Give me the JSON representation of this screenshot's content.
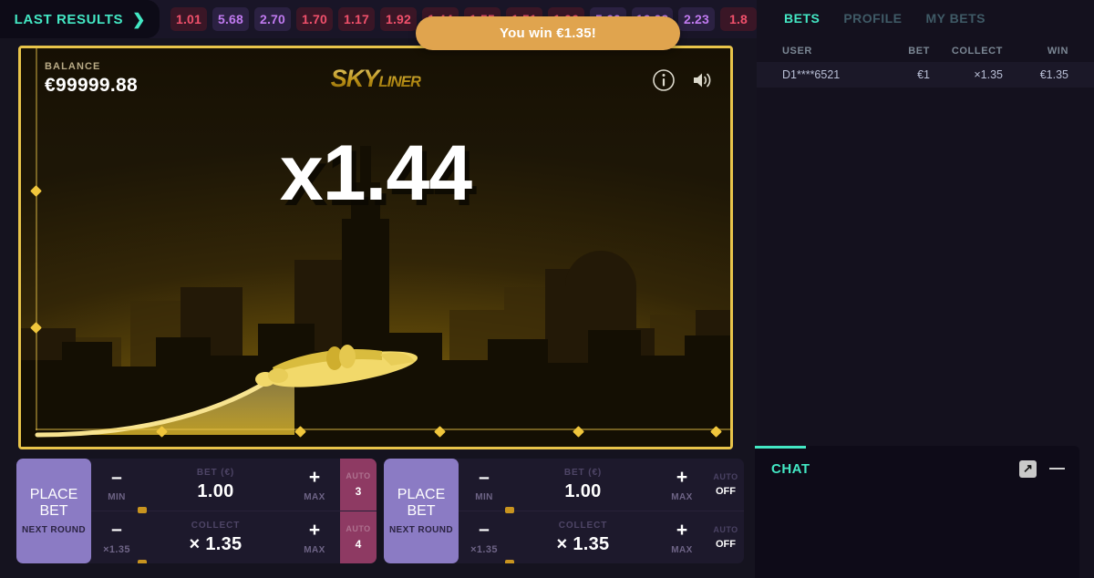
{
  "topbar": {
    "last_results_label": "LAST RESULTS",
    "chevron_icon": "chevron-right-icon",
    "results": [
      {
        "value": "1.01",
        "tone": "red"
      },
      {
        "value": "5.68",
        "tone": "violet"
      },
      {
        "value": "2.70",
        "tone": "violet"
      },
      {
        "value": "1.70",
        "tone": "red"
      },
      {
        "value": "1.17",
        "tone": "red"
      },
      {
        "value": "1.92",
        "tone": "red"
      },
      {
        "value": "1.44",
        "tone": "red"
      },
      {
        "value": "1.55",
        "tone": "red"
      },
      {
        "value": "1.51",
        "tone": "red"
      },
      {
        "value": "1.06",
        "tone": "red"
      },
      {
        "value": "5.60",
        "tone": "violet"
      },
      {
        "value": "16.09",
        "tone": "violet"
      },
      {
        "value": "2.23",
        "tone": "violet"
      },
      {
        "value": "1.8",
        "tone": "red"
      }
    ]
  },
  "toast": {
    "text": "You win €1.35!",
    "color": "#e0a44e"
  },
  "game": {
    "balance_label": "BALANCE",
    "balance_value": "€99999.88",
    "logo_main": "SKY",
    "logo_sub": "LINER",
    "multiplier": "x1.44",
    "info_icon": "info-icon",
    "sound_icon": "sound-on-icon",
    "plane_icon": "airplane-icon",
    "accent_color": "#e8c44a"
  },
  "bet_panels": [
    {
      "place_bet_label": "PLACE\nBET",
      "place_bet_line1": "PLACE",
      "place_bet_line2": "BET",
      "next_round_label": "NEXT ROUND",
      "bet_caption": "BET (€)",
      "bet_value": "1.00",
      "collect_caption": "COLLECT",
      "collect_value": "× 1.35",
      "minus_label": "–",
      "plus_label": "+",
      "min_label": "MIN",
      "max_label": "MAX",
      "mult_min_label": "×1.35",
      "auto_label": "AUTO",
      "auto_top_value": "3",
      "auto_bottom_value": "4",
      "auto_style": "number"
    },
    {
      "place_bet_line1": "PLACE",
      "place_bet_line2": "BET",
      "next_round_label": "NEXT ROUND",
      "bet_caption": "BET (€)",
      "bet_value": "1.00",
      "collect_caption": "COLLECT",
      "collect_value": "× 1.35",
      "minus_label": "–",
      "plus_label": "+",
      "min_label": "MIN",
      "max_label": "MAX",
      "mult_min_label": "×1.35",
      "auto_label": "AUTO",
      "auto_top_value": "OFF",
      "auto_bottom_value": "OFF",
      "auto_style": "off"
    }
  ],
  "sidebar": {
    "tabs": [
      {
        "label": "BETS",
        "active": true
      },
      {
        "label": "PROFILE",
        "active": false
      },
      {
        "label": "MY BETS",
        "active": false
      }
    ],
    "table": {
      "columns": [
        "USER",
        "BET",
        "COLLECT",
        "WIN"
      ],
      "rows": [
        {
          "user": "D1****6521",
          "bet": "€1",
          "collect": "×1.35",
          "win": "€1.35"
        }
      ]
    }
  },
  "chat": {
    "title": "CHAT",
    "expand_icon": "expand-arrow-icon",
    "minimize_icon": "minimize-icon"
  }
}
